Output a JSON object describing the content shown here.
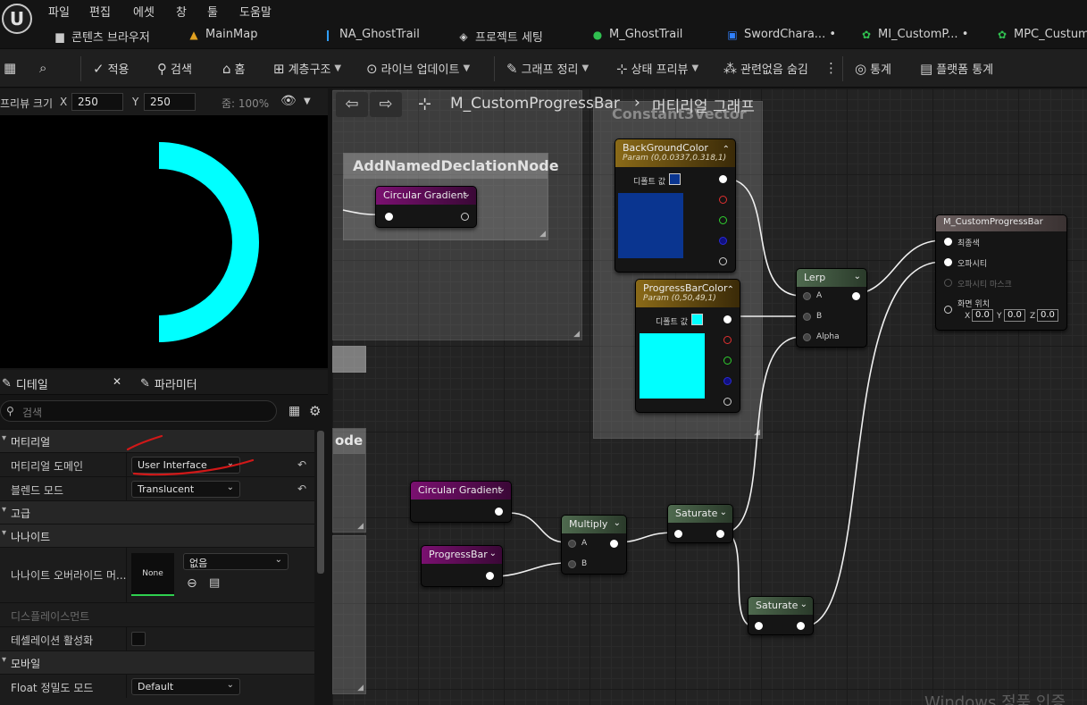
{
  "menu": [
    "파일",
    "편집",
    "에셋",
    "창",
    "툴",
    "도움말"
  ],
  "tabs": [
    {
      "label": "콘텐츠 브라우저",
      "icon": "folder-icon"
    },
    {
      "label": "MainMap",
      "icon": "level-icon"
    },
    {
      "label": "NA_GhostTrail",
      "icon": "niagara-icon"
    },
    {
      "label": "프로젝트 세팅",
      "icon": "settings-cube-icon"
    },
    {
      "label": "M_GhostTrail",
      "icon": "material-icon"
    },
    {
      "label": "SwordChara... •",
      "icon": "blueprint-icon"
    },
    {
      "label": "MI_CustomP... •",
      "icon": "material-instance-icon"
    },
    {
      "label": "MPC_Custum",
      "icon": "mpc-icon"
    }
  ],
  "toolbar": {
    "apply": "적용",
    "search": "검색",
    "home": "홈",
    "hierarchy": "계층구조",
    "live_update": "라이브 업데이트",
    "clean_graph": "그래프 정리",
    "state_preview": "상태 프리뷰",
    "hide_unrelated": "관련없음 숨김",
    "stats": "통계",
    "platform_stats": "플랫폼 통계"
  },
  "preview": {
    "size_label": "프리뷰 크기",
    "x_label": "X",
    "x_value": "250",
    "y_label": "Y",
    "y_value": "250",
    "zoom": "줌: 100%"
  },
  "details": {
    "tab_details": "디테일",
    "tab_params": "파라미터",
    "search_placeholder": "검색",
    "sections": {
      "material": "머티리얼",
      "advanced": "고급",
      "nanite": "나나이트",
      "mobile": "모바일"
    },
    "props": {
      "domain_name": "머티리얼 도메인",
      "domain_value": "User Interface",
      "blend_name": "블렌드 모드",
      "blend_value": "Translucent",
      "nanite_override_name": "나나이트 오버라이드 머...",
      "nanite_thumb": "None",
      "nanite_value": "없음",
      "displacement_name": "디스플레이스먼트",
      "tessellation_name": "테셀레이션 활성화",
      "float_precision_name": "Float 정밀도 모드",
      "float_precision_value": "Default"
    }
  },
  "graph": {
    "title": "M_CustomProgressBar",
    "subtitle": "머티리얼 그래프",
    "comments": {
      "declaration": "AddNamedDeclationNode",
      "constant": "Constant3Vector",
      "node_partial": "ode"
    },
    "nodes": {
      "circular_gradient_top": "Circular Gradient",
      "background_color": {
        "title": "BackGroundColor",
        "param": "Param (0,0.0337,0.318,1)",
        "default_label": "디폴트 값"
      },
      "progress_bar_color": {
        "title": "ProgressBarColor",
        "param": "Param (0,50,49,1)",
        "default_label": "디폴트 값"
      },
      "lerp": {
        "title": "Lerp",
        "a": "A",
        "b": "B",
        "alpha": "Alpha"
      },
      "output": {
        "title": "M_CustomProgressBar",
        "final_color": "최종색",
        "opacity": "오파시티",
        "opacity_mask": "오파시티 마스크",
        "screen_position": "화면 위치",
        "x": "X",
        "x_val": "0.0",
        "y": "Y",
        "y_val": "0.0",
        "z": "Z",
        "z_val": "0.0"
      },
      "circular_gradient": "Circular Gradient",
      "progress_bar": "ProgressBar",
      "multiply": {
        "title": "Multiply",
        "a": "A",
        "b": "B"
      },
      "saturate_1": "Saturate",
      "saturate_2": "Saturate"
    }
  },
  "colors": {
    "background_color_swatch": "#0a3590",
    "progress_bar_swatch": "#00ffff",
    "ring": "#00ffff",
    "param_header": "#7a5a10",
    "texture_header": "#7a1070",
    "math_header": "#3f5a3f",
    "output_header": "#5a5050",
    "annotation": "#d01818"
  },
  "watermark": "Windows 정품 인증"
}
